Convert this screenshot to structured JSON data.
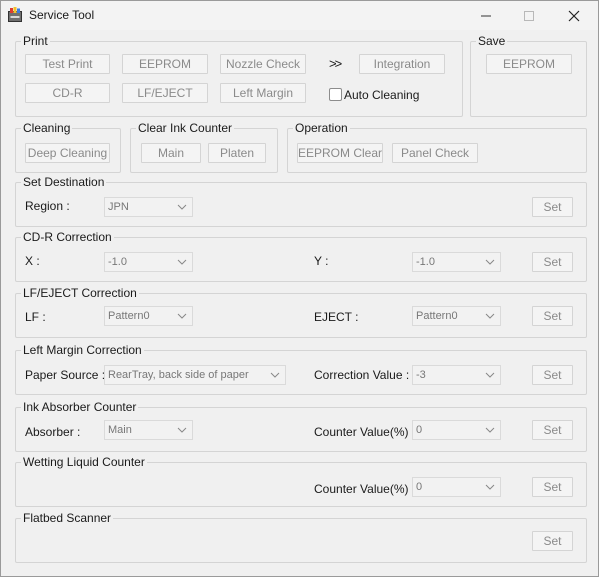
{
  "window": {
    "title": "Service Tool"
  },
  "print": {
    "title": "Print",
    "test_print": "Test Print",
    "eeprom": "EEPROM",
    "nozzle_check": "Nozzle Check",
    "arrow": ">>",
    "integration": "Integration",
    "cdr": "CD-R",
    "lf_eject": "LF/EJECT",
    "left_margin": "Left Margin",
    "auto_cleaning": "Auto Cleaning"
  },
  "save": {
    "title": "Save",
    "eeprom": "EEPROM"
  },
  "cleaning": {
    "title": "Cleaning",
    "deep_cleaning": "Deep Cleaning"
  },
  "clear_ink_counter": {
    "title": "Clear Ink Counter",
    "main": "Main",
    "platen": "Platen"
  },
  "operation": {
    "title": "Operation",
    "eeprom_clear": "EEPROM Clear",
    "panel_check": "Panel Check"
  },
  "set_destination": {
    "title": "Set Destination",
    "region_label": "Region :",
    "region_value": "JPN",
    "set": "Set"
  },
  "cdr_correction": {
    "title": "CD-R Correction",
    "x_label": "X :",
    "x_value": "-1.0",
    "y_label": "Y :",
    "y_value": "-1.0",
    "set": "Set"
  },
  "lf_eject_correction": {
    "title": "LF/EJECT Correction",
    "lf_label": "LF :",
    "lf_value": "Pattern0",
    "eject_label": "EJECT :",
    "eject_value": "Pattern0",
    "set": "Set"
  },
  "left_margin_correction": {
    "title": "Left Margin Correction",
    "paper_source_label": "Paper Source :",
    "paper_source_value": "RearTray, back side of paper",
    "correction_label": "Correction Value :",
    "correction_value": "-3",
    "set": "Set"
  },
  "ink_absorber_counter": {
    "title": "Ink Absorber Counter",
    "absorber_label": "Absorber :",
    "absorber_value": "Main",
    "counter_label": "Counter Value(%) :",
    "counter_value": "0",
    "set": "Set"
  },
  "wetting_liquid_counter": {
    "title": "Wetting Liquid Counter",
    "counter_label": "Counter Value(%) :",
    "counter_value": "0",
    "set": "Set"
  },
  "flatbed_scanner": {
    "title": "Flatbed Scanner",
    "set": "Set"
  }
}
